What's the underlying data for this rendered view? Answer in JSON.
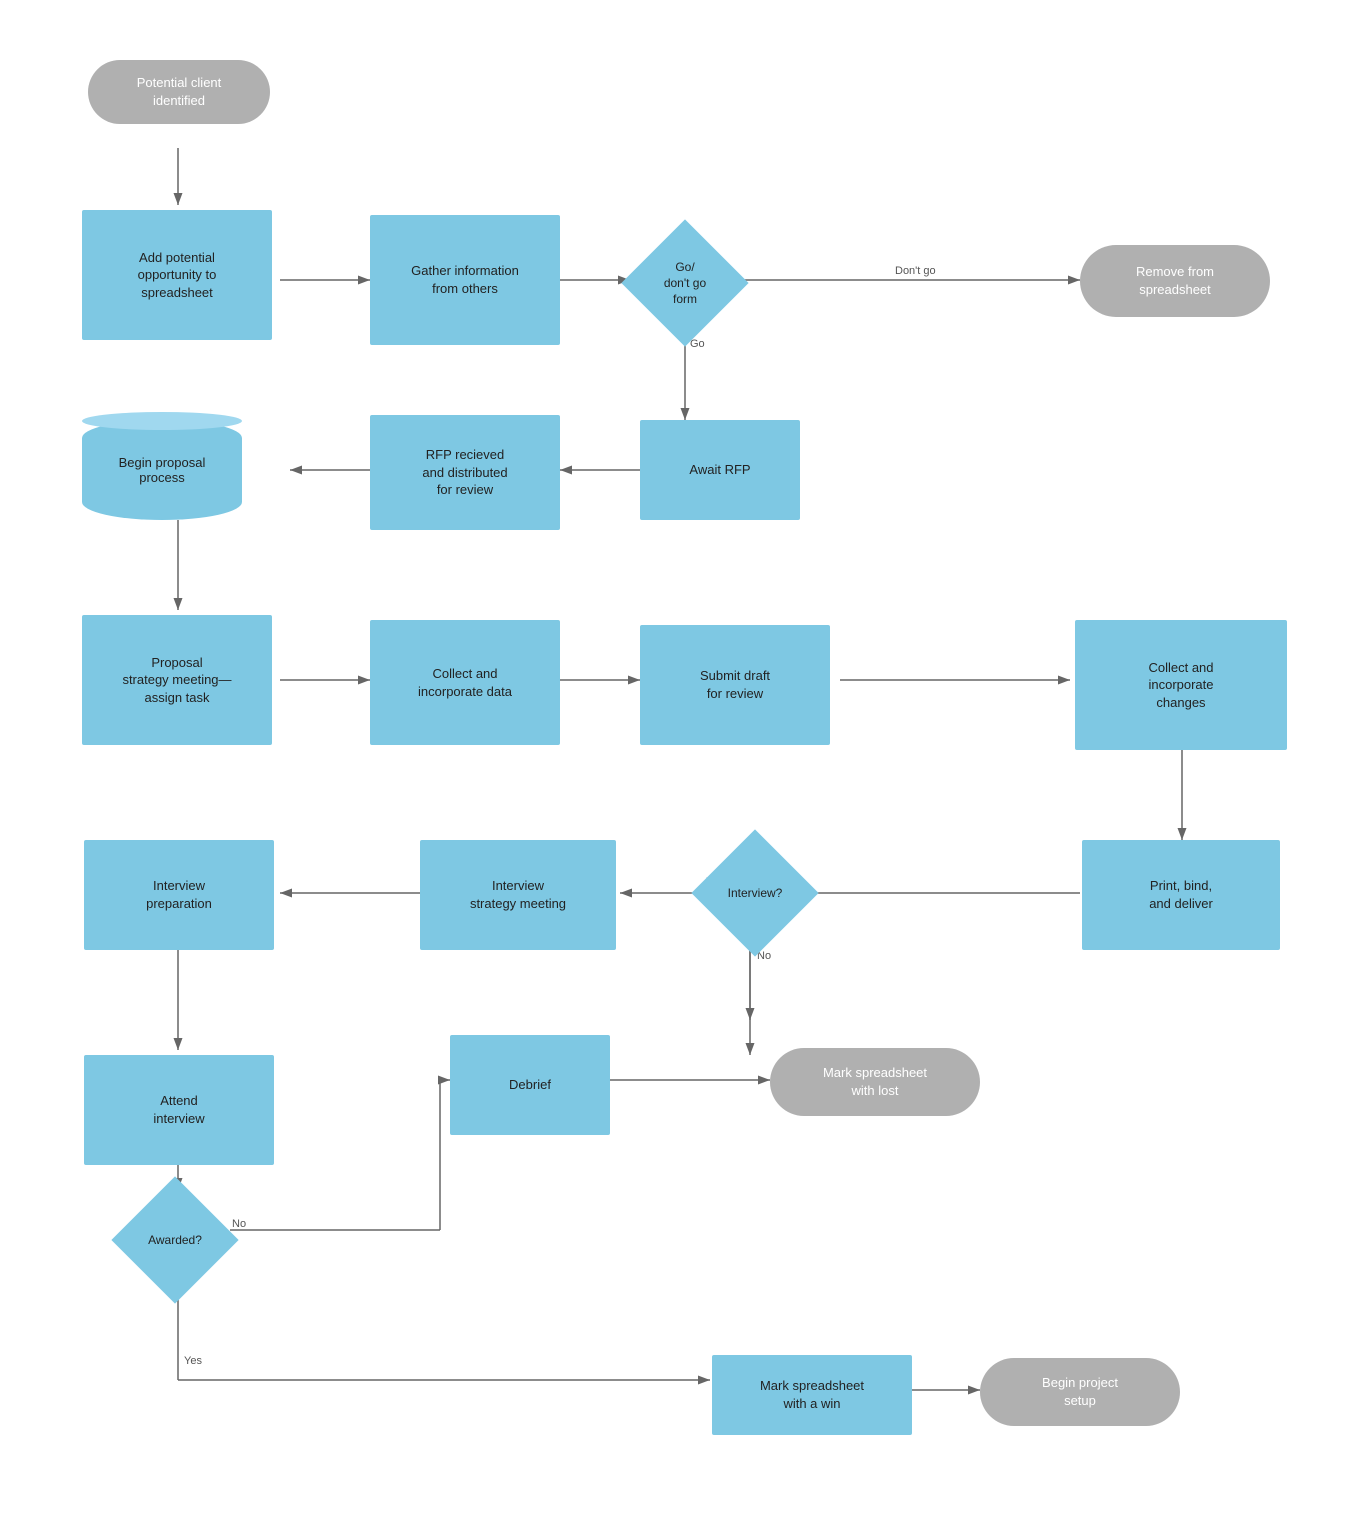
{
  "nodes": {
    "potential_client": {
      "label": "Potential client\nidentified"
    },
    "add_opportunity": {
      "label": "Add potential\nopportunity to\nspreadsheet"
    },
    "gather_info": {
      "label": "Gather information\nfrom others"
    },
    "go_dont_go": {
      "label": "Go/\ndon't go\nform"
    },
    "remove_spreadsheet": {
      "label": "Remove from\nspreadsheet"
    },
    "await_rfp": {
      "label": "Await RFP"
    },
    "rfp_received": {
      "label": "RFP recieved\nand distributed\nfor review"
    },
    "begin_proposal": {
      "label": "Begin proposal\nprocess"
    },
    "proposal_strategy": {
      "label": "Proposal\nstrategy meeting—\nassign task"
    },
    "collect_data": {
      "label": "Collect and\nincorporate data"
    },
    "submit_draft": {
      "label": "Submit draft\nfor review"
    },
    "collect_changes": {
      "label": "Collect and\nincorporate\nchanges"
    },
    "print_bind": {
      "label": "Print, bind,\nand deliver"
    },
    "interview_q": {
      "label": "Interview?"
    },
    "interview_strategy": {
      "label": "Interview\nstrategy meeting"
    },
    "interview_prep": {
      "label": "Interview\npreparation"
    },
    "attend_interview": {
      "label": "Attend\ninterview"
    },
    "awarded_q": {
      "label": "Awarded?"
    },
    "debrief": {
      "label": "Debrief"
    },
    "mark_lost": {
      "label": "Mark spreadsheet\nwith lost"
    },
    "mark_win": {
      "label": "Mark spreadsheet\nwith a win"
    },
    "begin_project": {
      "label": "Begin project\nsetup"
    }
  },
  "labels": {
    "go": "Go",
    "dont_go": "Don't go",
    "yes": "Yes",
    "no": "No"
  }
}
